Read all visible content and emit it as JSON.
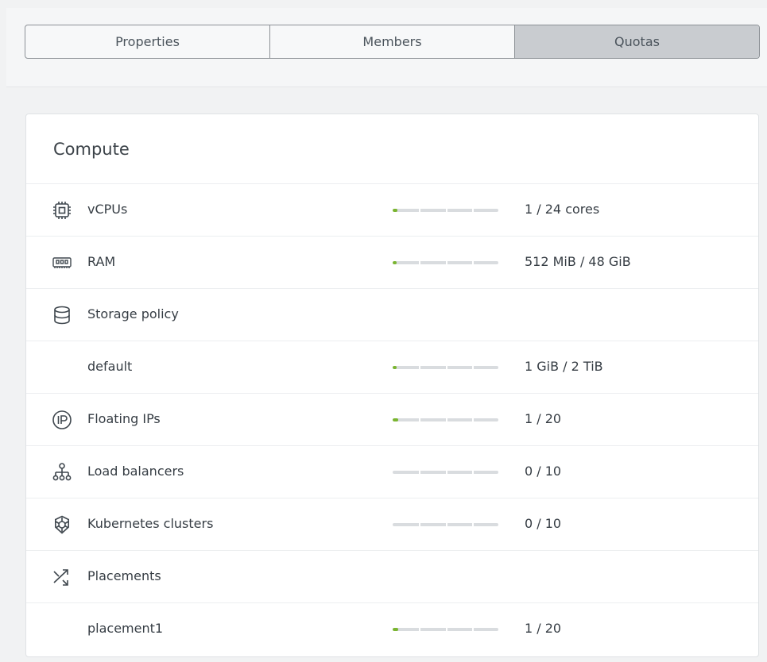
{
  "tabs": [
    {
      "label": "Properties",
      "active": false
    },
    {
      "label": "Members",
      "active": false
    },
    {
      "label": "Quotas",
      "active": true
    }
  ],
  "section": {
    "title": "Compute"
  },
  "quotas": [
    {
      "icon": "cpu-icon",
      "label": "vCPUs",
      "value": "1 / 24 cores",
      "usage": 0.042
    },
    {
      "icon": "ram-icon",
      "label": "RAM",
      "value": "512 MiB / 48 GiB",
      "usage": 0.01
    },
    {
      "icon": "database-icon",
      "label": "Storage policy"
    },
    {
      "label": "default",
      "value": "1 GiB / 2 TiB",
      "usage": 0.0005
    },
    {
      "icon": "floating-ip-icon",
      "label": "Floating IPs",
      "value": "1 / 20",
      "usage": 0.05
    },
    {
      "icon": "load-balancer-icon",
      "label": "Load balancers",
      "value": "0 / 10",
      "usage": 0
    },
    {
      "icon": "kubernetes-icon",
      "label": "Kubernetes clusters",
      "value": "0 / 10",
      "usage": 0
    },
    {
      "icon": "placement-icon",
      "label": "Placements"
    },
    {
      "label": "placement1",
      "value": "1 / 20",
      "usage": 0.05
    }
  ],
  "colors": {
    "usage_fill": "#7ab530",
    "bar_track": "#d9dcdf",
    "active_tab": "#c9ccd0"
  }
}
